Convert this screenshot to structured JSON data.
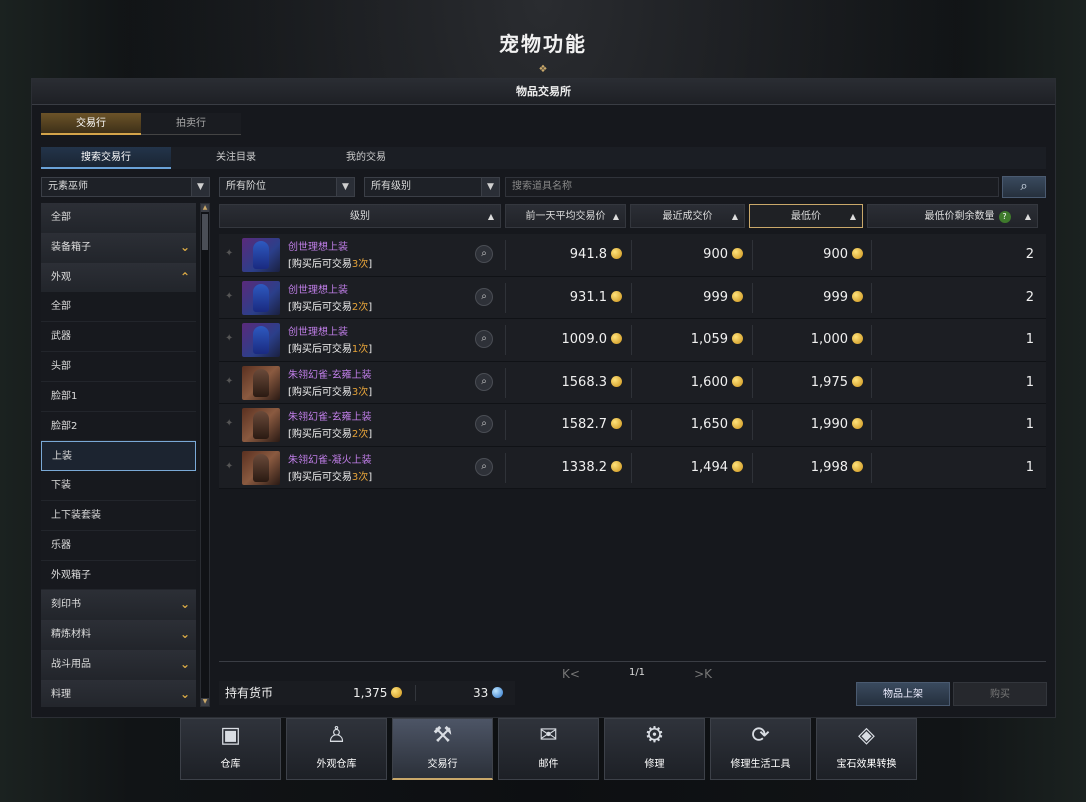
{
  "window_title": "宠物功能",
  "panel_title": "物品交易所",
  "top_tabs": [
    {
      "label": "交易行",
      "active": true
    },
    {
      "label": "拍卖行",
      "active": false
    }
  ],
  "sub_tabs": [
    {
      "label": "搜索交易行",
      "active": true
    },
    {
      "label": "关注目录",
      "active": false
    },
    {
      "label": "我的交易",
      "active": false
    }
  ],
  "filters": {
    "class_select": "元素巫师",
    "tier_select": "所有阶位",
    "grade_select": "所有级别",
    "search_placeholder": "搜索道具名称",
    "search_icon": "search-icon"
  },
  "sidebar": [
    {
      "label": "全部",
      "type": "cat"
    },
    {
      "label": "装备箱子",
      "type": "cat",
      "chev": "⌄"
    },
    {
      "label": "外观",
      "type": "cat",
      "chev": "⌃"
    },
    {
      "label": "全部",
      "type": "sub"
    },
    {
      "label": "武器",
      "type": "sub"
    },
    {
      "label": "头部",
      "type": "sub"
    },
    {
      "label": "脸部1",
      "type": "sub"
    },
    {
      "label": "脸部2",
      "type": "sub"
    },
    {
      "label": "上装",
      "type": "sub",
      "selected": true
    },
    {
      "label": "下装",
      "type": "sub"
    },
    {
      "label": "上下装套装",
      "type": "sub"
    },
    {
      "label": "乐器",
      "type": "sub"
    },
    {
      "label": "外观箱子",
      "type": "sub"
    },
    {
      "label": "刻印书",
      "type": "cat",
      "chev": "⌄"
    },
    {
      "label": "精炼材料",
      "type": "cat",
      "chev": "⌄"
    },
    {
      "label": "战斗用品",
      "type": "cat",
      "chev": "⌄"
    },
    {
      "label": "料理",
      "type": "cat",
      "chev": "⌄"
    }
  ],
  "columns": {
    "grade": "级别",
    "avg_price": "前一天平均交易价",
    "recent_price": "最近成交价",
    "lowest_price": "最低价",
    "lowest_remaining": "最低价剩余数量",
    "sort_glyph": "▲",
    "help_glyph": "?"
  },
  "items": [
    {
      "name": "创世理想上装",
      "desc_prefix": "[购买后可交易",
      "count": "3次",
      "desc_suffix": "]",
      "avg": "941.8",
      "recent": "900",
      "lowest": "900",
      "remaining": "2",
      "thumb": "blue"
    },
    {
      "name": "创世理想上装",
      "desc_prefix": "[购买后可交易",
      "count": "2次",
      "desc_suffix": "]",
      "avg": "931.1",
      "recent": "999",
      "lowest": "999",
      "remaining": "2",
      "thumb": "blue"
    },
    {
      "name": "创世理想上装",
      "desc_prefix": "[购买后可交易",
      "count": "1次",
      "desc_suffix": "]",
      "avg": "1009.0",
      "recent": "1,059",
      "lowest": "1,000",
      "remaining": "1",
      "thumb": "blue"
    },
    {
      "name": "朱翎幻雀-玄雍上装",
      "desc_prefix": "[购买后可交易",
      "count": "3次",
      "desc_suffix": "]",
      "avg": "1568.3",
      "recent": "1,600",
      "lowest": "1,975",
      "remaining": "1",
      "thumb": "red"
    },
    {
      "name": "朱翎幻雀-玄雍上装",
      "desc_prefix": "[购买后可交易",
      "count": "2次",
      "desc_suffix": "]",
      "avg": "1582.7",
      "recent": "1,650",
      "lowest": "1,990",
      "remaining": "1",
      "thumb": "red"
    },
    {
      "name": "朱翎幻雀-凝火上装",
      "desc_prefix": "[购买后可交易",
      "count": "3次",
      "desc_suffix": "]",
      "avg": "1338.2",
      "recent": "1,494",
      "lowest": "1,998",
      "remaining": "1",
      "thumb": "red"
    }
  ],
  "footer": {
    "currency_label": "持有货币",
    "gold": "1,375",
    "crystal": "33",
    "page": "1/1",
    "first_glyph": "K<",
    "last_glyph": ">K",
    "sell_button": "物品上架",
    "buy_button": "购买"
  },
  "dock": [
    {
      "label": "仓库",
      "icon": "chest-icon",
      "glyph": "▣"
    },
    {
      "label": "外观仓库",
      "icon": "wardrobe-icon",
      "glyph": "♙"
    },
    {
      "label": "交易行",
      "icon": "gavel-icon",
      "glyph": "⚒",
      "active": true
    },
    {
      "label": "邮件",
      "icon": "mail-icon",
      "glyph": "✉"
    },
    {
      "label": "修理",
      "icon": "anvil-icon",
      "glyph": "⚙"
    },
    {
      "label": "修理生活工具",
      "icon": "tool-repair-icon",
      "glyph": "⟳"
    },
    {
      "label": "宝石效果转换",
      "icon": "gem-convert-icon",
      "glyph": "◈"
    }
  ]
}
